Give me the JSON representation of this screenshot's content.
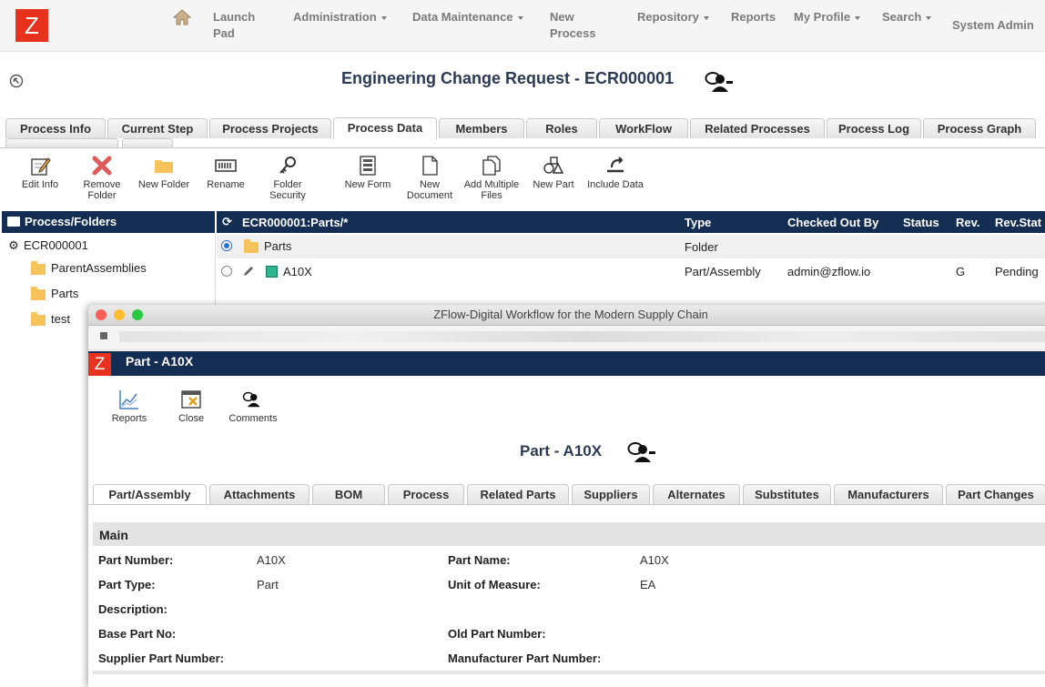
{
  "topnav": {
    "logo": "Z",
    "items": [
      {
        "label": "Launch Pad",
        "caret": false
      },
      {
        "label": "Administration",
        "caret": true
      },
      {
        "label": "Data Maintenance",
        "caret": true
      },
      {
        "label": "New Process",
        "caret": false
      },
      {
        "label": "Repository",
        "caret": true
      },
      {
        "label": "Reports",
        "caret": false
      },
      {
        "label": "My Profile",
        "caret": true
      },
      {
        "label": "Search",
        "caret": true
      },
      {
        "label": "System Admin",
        "caret": false
      }
    ]
  },
  "page": {
    "title": "Engineering Change Request - ECR000001"
  },
  "tabs": [
    "Process Info",
    "Current Step",
    "Process Projects",
    "Process Data",
    "Members",
    "Roles",
    "WorkFlow",
    "Related Processes",
    "Process Log",
    "Process Graph"
  ],
  "active_tab": "Process Data",
  "toolbar": [
    {
      "label": "Edit Info",
      "icon": "edit-icon"
    },
    {
      "label": "Remove Folder",
      "icon": "remove-icon"
    },
    {
      "label": "New Folder",
      "icon": "folder-icon"
    },
    {
      "label": "Rename",
      "icon": "rename-icon"
    },
    {
      "label": "Folder Security",
      "icon": "key-icon"
    },
    {
      "label": "New Form",
      "icon": "form-icon"
    },
    {
      "label": "New Document",
      "icon": "document-icon"
    },
    {
      "label": "Add Multiple Files",
      "icon": "files-icon"
    },
    {
      "label": "New Part",
      "icon": "part-icon"
    },
    {
      "label": "Include Data",
      "icon": "include-icon"
    }
  ],
  "tree": {
    "header": "Process/Folders",
    "root": "ECR000001",
    "children": [
      "ParentAssemblies",
      "Parts",
      "test"
    ]
  },
  "grid": {
    "path": "ECR000001:Parts/*",
    "columns": [
      "Type",
      "Checked Out By",
      "Status",
      "Rev.",
      "Rev.Stat"
    ],
    "rows": [
      {
        "name": "Parts",
        "type": "Folder",
        "checked_out_by": "",
        "status": "",
        "rev": "",
        "rev_status": ""
      },
      {
        "name": "A10X",
        "type": "Part/Assembly",
        "checked_out_by": "admin@zflow.io",
        "status": "",
        "rev": "G",
        "rev_status": "Pending"
      }
    ]
  },
  "popup": {
    "window_title": "ZFlow-Digital Workflow for the Modern Supply Chain",
    "header_title": "Part - A10X",
    "logo": "Z",
    "toolbar": [
      {
        "label": "Reports",
        "icon": "reports-icon"
      },
      {
        "label": "Close",
        "icon": "close-icon"
      },
      {
        "label": "Comments",
        "icon": "comments-icon"
      }
    ],
    "title": "Part - A10X",
    "tabs": [
      "Part/Assembly",
      "Attachments",
      "BOM",
      "Process",
      "Related Parts",
      "Suppliers",
      "Alternates",
      "Substitutes",
      "Manufacturers",
      "Part Changes"
    ],
    "active_tab": "Part/Assembly",
    "section": "Main",
    "fields": {
      "part_number": {
        "label": "Part Number:",
        "value": "A10X"
      },
      "part_name": {
        "label": "Part Name:",
        "value": "A10X"
      },
      "part_type": {
        "label": "Part Type:",
        "value": "Part"
      },
      "uom": {
        "label": "Unit of Measure:",
        "value": "EA"
      },
      "description": {
        "label": "Description:",
        "value": ""
      },
      "base_part": {
        "label": "Base Part No:",
        "value": ""
      },
      "old_part": {
        "label": "Old Part Number:",
        "value": ""
      },
      "supplier_part": {
        "label": "Supplier Part Number:",
        "value": ""
      },
      "mfr_part": {
        "label": "Manufacturer Part Number:",
        "value": ""
      }
    }
  },
  "colors": {
    "navy": "#142d52",
    "logo_red": "#e8321e",
    "title_navy": "#2b3a55"
  }
}
